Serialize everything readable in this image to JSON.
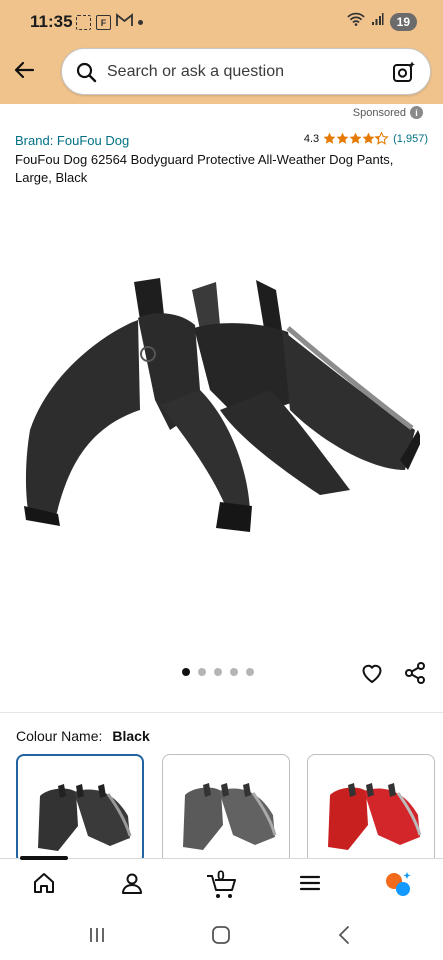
{
  "status_bar": {
    "time": "11:35",
    "icon_f": "F",
    "battery": "19"
  },
  "search": {
    "placeholder": "Search or ask a question"
  },
  "sponsored": {
    "label": "Sponsored",
    "info": "i"
  },
  "product": {
    "brand": "Brand: FouFou Dog",
    "rating": "4.3",
    "review_count": "(1,957)",
    "title": "FouFou Dog 62564 Bodyguard Protective All-Weather Dog Pants, Large, Black",
    "image_icon": "dog-pants-product-image"
  },
  "gallery": {
    "image_count": 5,
    "active_index": 0
  },
  "colour": {
    "label": "Colour Name:",
    "value": "Black"
  },
  "swatches": [
    {
      "name": "black",
      "selected": true
    },
    {
      "name": "grey",
      "selected": false
    },
    {
      "name": "red",
      "selected": false
    }
  ],
  "cart": {
    "count": "0"
  },
  "colors": {
    "header": "#f0c38d",
    "link": "#007185",
    "star": "#e67a00",
    "selected": "#2162a1"
  }
}
